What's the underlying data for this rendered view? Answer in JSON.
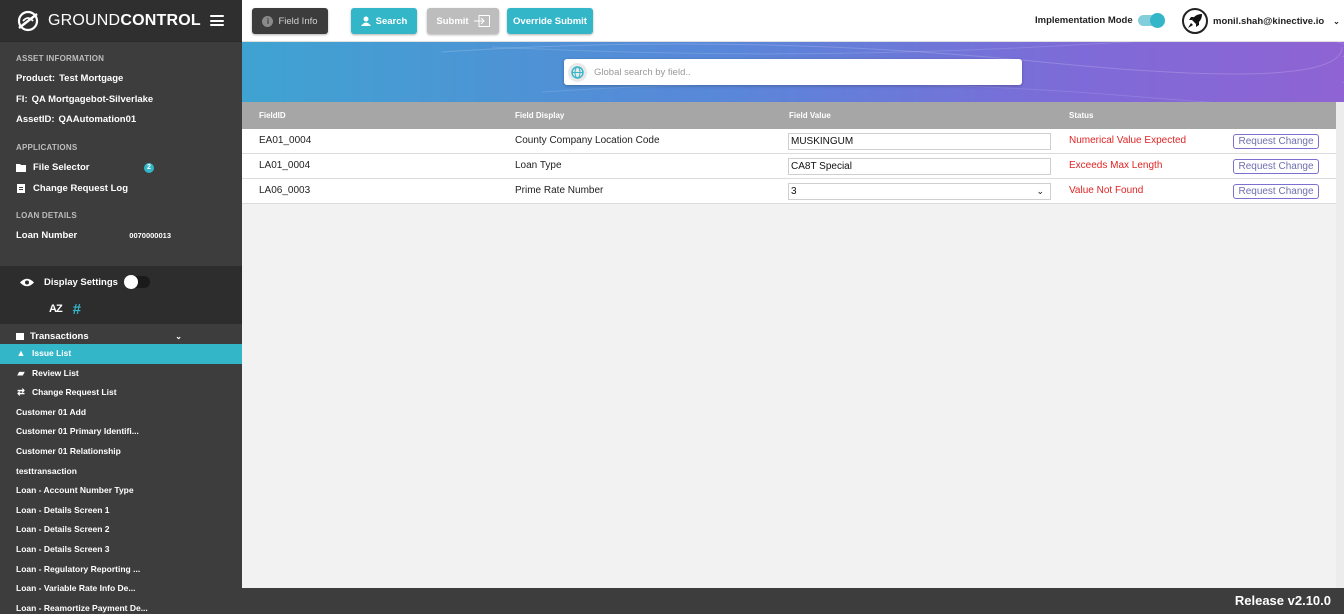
{
  "app": {
    "brand_light": "GROUND",
    "brand_bold": "CONTROL",
    "release": "Release v2.10.0"
  },
  "colors": {
    "accent": "#34b6c9",
    "sidebar": "#3d3d3d",
    "error": "#e02424",
    "request_border": "#7b6fd0"
  },
  "toolbar": {
    "field_info": "Field Info",
    "search": "Search",
    "submit": "Submit",
    "override_submit": "Override Submit",
    "implementation_mode": "Implementation Mode",
    "implementation_mode_on": true,
    "user_email": "monil.shah@kinective.io"
  },
  "global_search": {
    "placeholder": "Global search by field.."
  },
  "sidebar": {
    "asset_info_header": "ASSET INFORMATION",
    "product_label": "Product:",
    "product_value": "Test Mortgage",
    "fi_label": "FI:",
    "fi_value": "QA Mortgagebot-Silverlake",
    "asset_id_label": "AssetID:",
    "asset_id_value": "QAAutomation01",
    "applications_header": "APPLICATIONS",
    "file_selector": "File Selector",
    "file_selector_badge": "2",
    "change_request_log": "Change Request Log",
    "loan_details_header": "LOAN DETAILS",
    "loan_number_label": "Loan Number",
    "loan_number_value": "0070000013",
    "display_settings": "Display Settings",
    "sort_alpha": "AZ",
    "sort_number": "#",
    "transactions": "Transactions",
    "nav_items": [
      {
        "label": "Issue List",
        "icon": "warning-icon",
        "active": true
      },
      {
        "label": "Review List",
        "icon": "review-icon",
        "active": false
      },
      {
        "label": "Change Request List",
        "icon": "change-icon",
        "active": false
      }
    ],
    "transactions_list": [
      "Customer 01 Add",
      "Customer 01 Primary Identifi...",
      "Customer 01 Relationship",
      "testtransaction",
      "Loan - Account Number Type",
      "Loan - Details Screen 1",
      "Loan - Details Screen 2",
      "Loan - Details Screen 3",
      "Loan - Regulatory Reporting ...",
      "Loan - Variable Rate Info De...",
      "Loan - Reamortize Payment De..."
    ]
  },
  "table": {
    "headers": [
      "FieldID",
      "Field Display",
      "Field Value",
      "Status"
    ],
    "request_change_label": "Request Change",
    "rows": [
      {
        "field_id": "EA01_0004",
        "display": "County Company Location Code",
        "value": "MUSKINGUM",
        "status": "Numerical Value Expected",
        "dropdown": false
      },
      {
        "field_id": "LA01_0004",
        "display": "Loan Type",
        "value": "CA8T Special",
        "status": "Exceeds Max Length",
        "dropdown": false
      },
      {
        "field_id": "LA06_0003",
        "display": "Prime Rate Number",
        "value": "3",
        "status": "Value Not Found",
        "dropdown": true
      }
    ]
  }
}
